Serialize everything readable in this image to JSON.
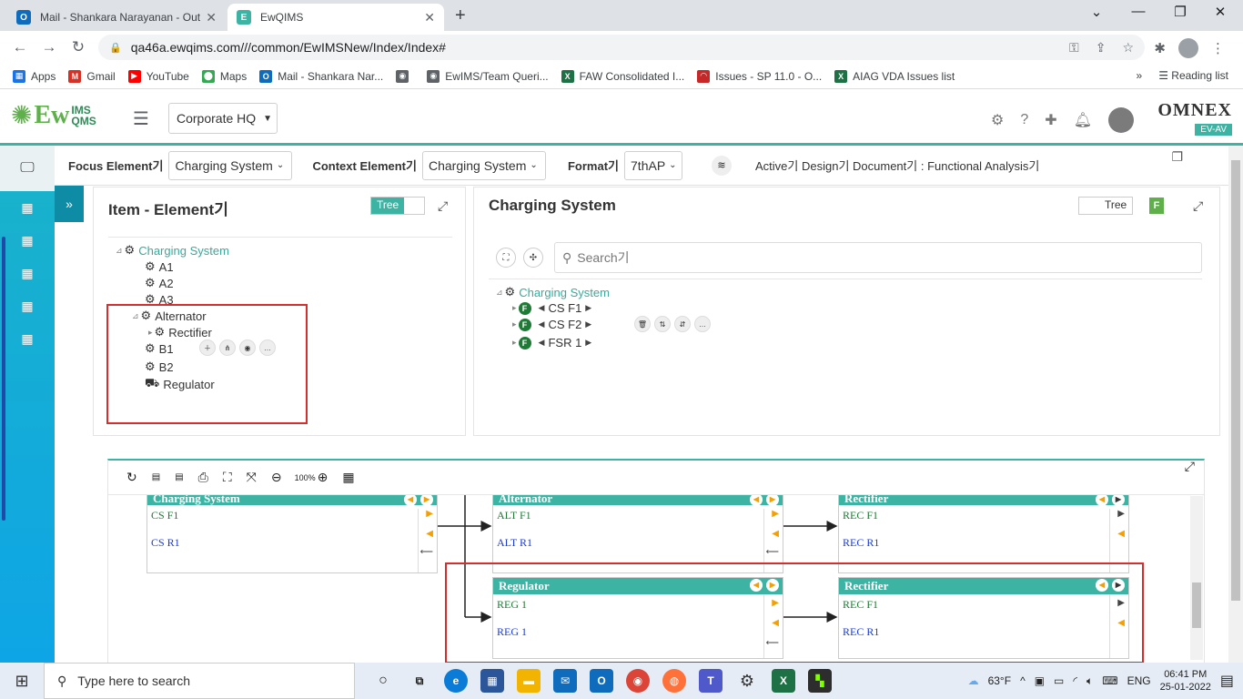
{
  "browser": {
    "tabs": [
      {
        "title": "Mail - Shankara Narayanan - Out",
        "favicon": "outlook-icon",
        "color": "#0f6cbd",
        "active": false
      },
      {
        "title": "EwQIMS",
        "favicon": "ewqims-icon",
        "color": "#3db3a3",
        "active": true
      }
    ],
    "url": "qa46a.ewqims.com///common/EwIMSNew/Index/Index#",
    "bookmarks": [
      {
        "label": "Apps",
        "color": "#1a73e8"
      },
      {
        "label": "Gmail",
        "color": "#d93025"
      },
      {
        "label": "YouTube",
        "color": "#ff0000"
      },
      {
        "label": "Maps",
        "color": "#34a853"
      },
      {
        "label": "Mail - Shankara Nar...",
        "color": "#0f6cbd"
      },
      {
        "label": "",
        "color": "#5f6368"
      },
      {
        "label": "EwIMS/Team Queri...",
        "color": "#5f6368"
      },
      {
        "label": "FAW Consolidated I...",
        "color": "#1e7145"
      },
      {
        "label": "Issues - SP 11.0 - O...",
        "color": "#c62828"
      },
      {
        "label": "AIAG VDA Issues list",
        "color": "#1e7145"
      }
    ],
    "more_bookmarks": "»",
    "reading_list": "Reading list"
  },
  "app": {
    "logo_ew": "Ew",
    "logo_ims_top": "IMS",
    "logo_ims_bottom": "QMS",
    "site": "Corporate HQ",
    "brand_top": "OMNEX",
    "brand_bottom": "EV-AV"
  },
  "toolbar": {
    "focus_label": "Focus Element기",
    "focus_value": "Charging System",
    "context_label": "Context Element기",
    "context_value": "Charging System",
    "format_label": "Format기",
    "format_value": "7thAP",
    "status": "Active기 Design기 Document기 : Functional Analysis기"
  },
  "left_panel": {
    "title": "Item - Element기",
    "toggle": "Tree",
    "tree": {
      "root": "Charging System",
      "children": [
        "A1",
        "A2",
        "A3",
        "Alternator",
        "Rectifier",
        "B1",
        "B2",
        "Regulator"
      ]
    }
  },
  "right_panel": {
    "title": "Charging System",
    "toggle": "Tree",
    "badge": "F",
    "search_placeholder": "Search기",
    "tree": {
      "root": "Charging System",
      "functions": [
        {
          "badge": "F",
          "label": "CS F1"
        },
        {
          "badge": "F",
          "label": "CS F2"
        },
        {
          "badge": "F",
          "label": "FSR 1"
        }
      ]
    }
  },
  "diagram": {
    "zoom": "100%",
    "boxes": [
      {
        "id": "cs",
        "title": "Charging System",
        "func": "CS F1",
        "req": "CS R1"
      },
      {
        "id": "alt",
        "title": "Alternator",
        "func": "ALT F1",
        "req": "ALT R1"
      },
      {
        "id": "rec1",
        "title": "Rectifier",
        "func": "REC F1",
        "req": "REC R1"
      },
      {
        "id": "reg",
        "title": "Regulator",
        "func": "REG 1",
        "req": "REG 1"
      },
      {
        "id": "rec2",
        "title": "Rectifier",
        "func": "REC F1",
        "req": "REC R1"
      }
    ]
  },
  "taskbar": {
    "search_placeholder": "Type here to search",
    "weather": "63°F",
    "language": "ENG",
    "time": "06:41 PM",
    "date": "25-01-2022"
  }
}
